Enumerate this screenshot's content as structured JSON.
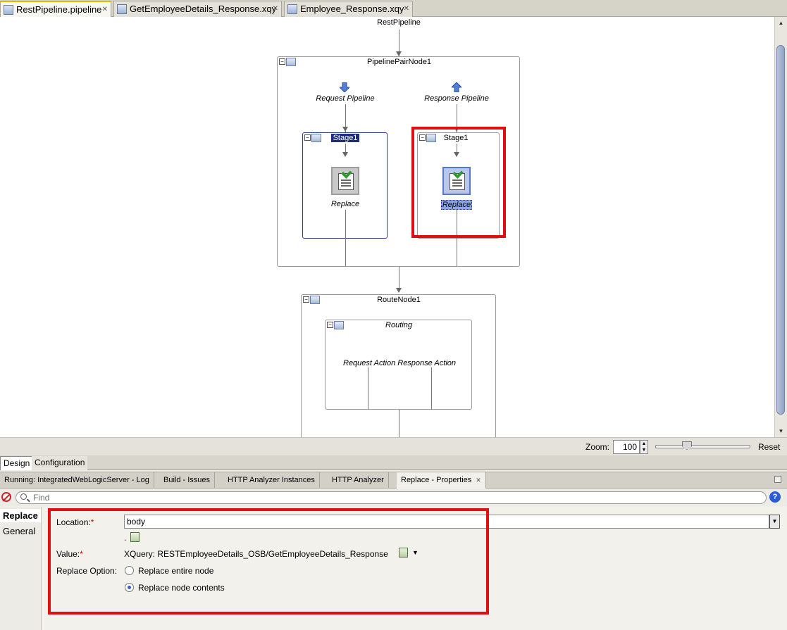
{
  "editor_tabs": [
    {
      "label": "RestPipeline.pipeline",
      "active": true
    },
    {
      "label": "GetEmployeeDetails_Response.xqy",
      "active": false
    },
    {
      "label": "Employee_Response.xqy",
      "active": false
    }
  ],
  "canvas": {
    "root_label": "RestPipeline",
    "pipeline_pair": {
      "title": "PipelinePairNode1",
      "request_label": "Request Pipeline",
      "response_label": "Response Pipeline",
      "request_stage": {
        "title": "Stage1",
        "action": "Replace"
      },
      "response_stage": {
        "title": "Stage1",
        "action": "Replace"
      }
    },
    "route_node": {
      "title": "RouteNode1",
      "routing_title": "Routing",
      "actions_label": "Request Action Response Action"
    }
  },
  "zoom": {
    "label": "Zoom:",
    "value": "100",
    "reset": "Reset"
  },
  "view_tabs": [
    {
      "label": "Design",
      "active": true
    },
    {
      "label": "Configuration",
      "active": false
    }
  ],
  "log_tabs": [
    {
      "label": "Running: IntegratedWebLogicServer - Log"
    },
    {
      "label": "Build - Issues"
    },
    {
      "label": "HTTP Analyzer Instances"
    },
    {
      "label": "HTTP Analyzer"
    },
    {
      "label": "Replace - Properties",
      "active": true
    }
  ],
  "find": {
    "placeholder": "Find"
  },
  "properties": {
    "section_title": "Replace",
    "section_item": "General",
    "location_label": "Location:",
    "location_value": "body",
    "location_sub": ".",
    "value_label": "Value:",
    "value_text": "XQuery: RESTEmployeeDetails_OSB/GetEmployeeDetails_Response",
    "replace_option_label": "Replace Option:",
    "options": [
      {
        "label": "Replace entire node",
        "checked": false
      },
      {
        "label": "Replace node contents",
        "checked": true
      }
    ],
    "required_mark": "*"
  },
  "colors": {
    "highlight_box": "#e01010",
    "selection": "#2b3a8c"
  }
}
